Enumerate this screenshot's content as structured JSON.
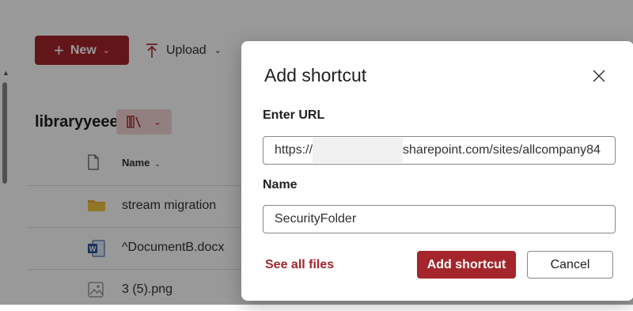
{
  "toolbar": {
    "new_label": "New",
    "upload_label": "Upload"
  },
  "library": {
    "title": "libraryyeee"
  },
  "list": {
    "name_header": "Name",
    "items": [
      {
        "label": "stream migration",
        "icon": "folder-icon"
      },
      {
        "label": "^DocumentB.docx",
        "icon": "word-doc-icon"
      },
      {
        "label": "3 (5).png",
        "icon": "image-file-icon"
      }
    ]
  },
  "dialog": {
    "title": "Add shortcut",
    "url_label": "Enter URL",
    "url_value_prefix": "https://",
    "url_value_suffix": "sharepoint.com/sites/allcompany84",
    "name_label": "Name",
    "name_value": "SecurityFolder",
    "see_all_label": "See all files",
    "primary_button": "Add shortcut",
    "cancel_button": "Cancel"
  },
  "colors": {
    "accent": "#a4262c",
    "accent_light": "#f3d6d8",
    "folder": "#e8b130",
    "word": "#2b579a"
  }
}
